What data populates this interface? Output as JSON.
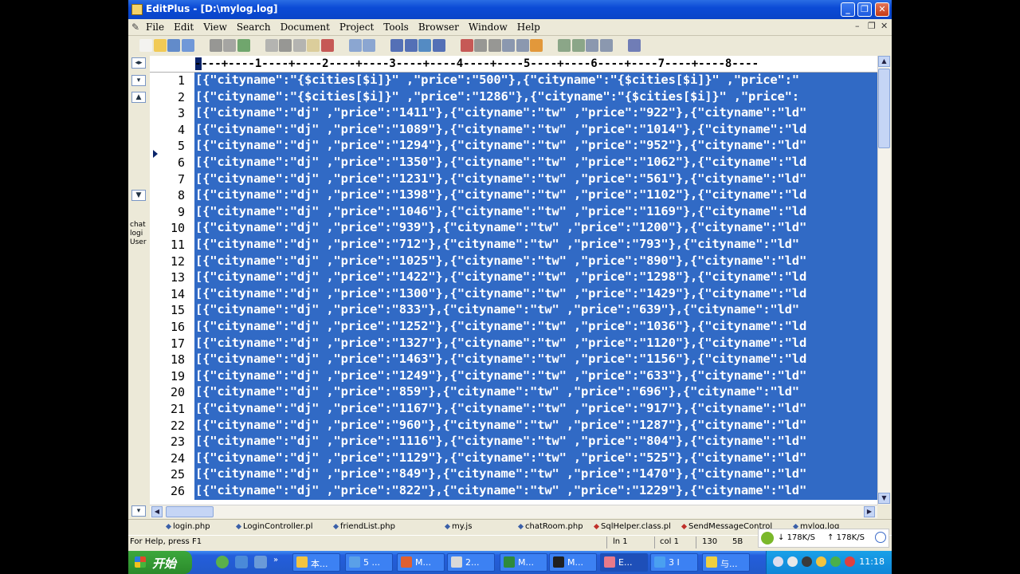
{
  "window": {
    "title": "EditPlus - [D:\\mylog.log]",
    "buttons": {
      "minimize": "_",
      "restore": "❐",
      "close": "✕"
    }
  },
  "menubar": {
    "items": [
      "File",
      "Edit",
      "View",
      "Search",
      "Document",
      "Project",
      "Tools",
      "Browser",
      "Window",
      "Help"
    ],
    "mdi_buttons": {
      "minimize": "–",
      "restore": "❐",
      "close": "✕"
    }
  },
  "toolbar": {
    "icons": [
      "new-file-icon",
      "open-folder-icon",
      "save-icon",
      "save-all-icon",
      "print-icon",
      "print-preview-icon",
      "spell-check-icon",
      "clipboard-icon",
      "cut-icon",
      "copy-icon",
      "paste-icon",
      "delete-icon",
      "undo-icon",
      "redo-icon",
      "find-icon",
      "replace-icon",
      "find-in-files-icon",
      "goto-icon",
      "font-icon",
      "hex-icon",
      "word-wrap-icon",
      "indent-icon",
      "ruler-icon",
      "check-icon",
      "browser-icon",
      "view-icon",
      "layout-icon",
      "fullscreen-icon",
      "help-icon"
    ]
  },
  "left_panel": {
    "lines": [
      "chat",
      "logi",
      "User"
    ]
  },
  "ruler": {
    "text": "----+----1----+----2----+----3----+----4----+----5----+----6----+----7----+----8----"
  },
  "editor": {
    "lines": [
      {
        "n": "1",
        "text": "[{\"cityname\":\"{$cities[$i]}\" ,\"price\":\"500\"},{\"cityname\":\"{$cities[$i]}\" ,\"price\":\""
      },
      {
        "n": "2",
        "text": "[{\"cityname\":\"{$cities[$i]}\" ,\"price\":\"1286\"},{\"cityname\":\"{$cities[$i]}\" ,\"price\":"
      },
      {
        "n": "3",
        "text": "[{\"cityname\":\"dj\" ,\"price\":\"1411\"},{\"cityname\":\"tw\" ,\"price\":\"922\"},{\"cityname\":\"ld\""
      },
      {
        "n": "4",
        "text": "[{\"cityname\":\"dj\" ,\"price\":\"1089\"},{\"cityname\":\"tw\" ,\"price\":\"1014\"},{\"cityname\":\"ld"
      },
      {
        "n": "5",
        "text": "[{\"cityname\":\"dj\" ,\"price\":\"1294\"},{\"cityname\":\"tw\" ,\"price\":\"952\"},{\"cityname\":\"ld\""
      },
      {
        "n": "6",
        "text": "[{\"cityname\":\"dj\" ,\"price\":\"1350\"},{\"cityname\":\"tw\" ,\"price\":\"1062\"},{\"cityname\":\"ld"
      },
      {
        "n": "7",
        "text": "[{\"cityname\":\"dj\" ,\"price\":\"1231\"},{\"cityname\":\"tw\" ,\"price\":\"561\"},{\"cityname\":\"ld\""
      },
      {
        "n": "8",
        "text": "[{\"cityname\":\"dj\" ,\"price\":\"1398\"},{\"cityname\":\"tw\" ,\"price\":\"1102\"},{\"cityname\":\"ld"
      },
      {
        "n": "9",
        "text": "[{\"cityname\":\"dj\" ,\"price\":\"1046\"},{\"cityname\":\"tw\" ,\"price\":\"1169\"},{\"cityname\":\"ld"
      },
      {
        "n": "10",
        "text": "[{\"cityname\":\"dj\" ,\"price\":\"939\"},{\"cityname\":\"tw\" ,\"price\":\"1200\"},{\"cityname\":\"ld\""
      },
      {
        "n": "11",
        "text": "[{\"cityname\":\"dj\" ,\"price\":\"712\"},{\"cityname\":\"tw\" ,\"price\":\"793\"},{\"cityname\":\"ld\" "
      },
      {
        "n": "12",
        "text": "[{\"cityname\":\"dj\" ,\"price\":\"1025\"},{\"cityname\":\"tw\" ,\"price\":\"890\"},{\"cityname\":\"ld\""
      },
      {
        "n": "13",
        "text": "[{\"cityname\":\"dj\" ,\"price\":\"1422\"},{\"cityname\":\"tw\" ,\"price\":\"1298\"},{\"cityname\":\"ld"
      },
      {
        "n": "14",
        "text": "[{\"cityname\":\"dj\" ,\"price\":\"1300\"},{\"cityname\":\"tw\" ,\"price\":\"1429\"},{\"cityname\":\"ld"
      },
      {
        "n": "15",
        "text": "[{\"cityname\":\"dj\" ,\"price\":\"833\"},{\"cityname\":\"tw\" ,\"price\":\"639\"},{\"cityname\":\"ld\" "
      },
      {
        "n": "16",
        "text": "[{\"cityname\":\"dj\" ,\"price\":\"1252\"},{\"cityname\":\"tw\" ,\"price\":\"1036\"},{\"cityname\":\"ld"
      },
      {
        "n": "17",
        "text": "[{\"cityname\":\"dj\" ,\"price\":\"1327\"},{\"cityname\":\"tw\" ,\"price\":\"1120\"},{\"cityname\":\"ld"
      },
      {
        "n": "18",
        "text": "[{\"cityname\":\"dj\" ,\"price\":\"1463\"},{\"cityname\":\"tw\" ,\"price\":\"1156\"},{\"cityname\":\"ld"
      },
      {
        "n": "19",
        "text": "[{\"cityname\":\"dj\" ,\"price\":\"1249\"},{\"cityname\":\"tw\" ,\"price\":\"633\"},{\"cityname\":\"ld\""
      },
      {
        "n": "20",
        "text": "[{\"cityname\":\"dj\" ,\"price\":\"859\"},{\"cityname\":\"tw\" ,\"price\":\"696\"},{\"cityname\":\"ld\" "
      },
      {
        "n": "21",
        "text": "[{\"cityname\":\"dj\" ,\"price\":\"1167\"},{\"cityname\":\"tw\" ,\"price\":\"917\"},{\"cityname\":\"ld\""
      },
      {
        "n": "22",
        "text": "[{\"cityname\":\"dj\" ,\"price\":\"960\"},{\"cityname\":\"tw\" ,\"price\":\"1287\"},{\"cityname\":\"ld\""
      },
      {
        "n": "23",
        "text": "[{\"cityname\":\"dj\" ,\"price\":\"1116\"},{\"cityname\":\"tw\" ,\"price\":\"804\"},{\"cityname\":\"ld\""
      },
      {
        "n": "24",
        "text": "[{\"cityname\":\"dj\" ,\"price\":\"1129\"},{\"cityname\":\"tw\" ,\"price\":\"525\"},{\"cityname\":\"ld\""
      },
      {
        "n": "25",
        "text": "[{\"cityname\":\"dj\" ,\"price\":\"849\"},{\"cityname\":\"tw\" ,\"price\":\"1470\"},{\"cityname\":\"ld\""
      },
      {
        "n": "26",
        "text": "[{\"cityname\":\"dj\" ,\"price\":\"822\"},{\"cityname\":\"tw\" ,\"price\":\"1229\"},{\"cityname\":\"ld\""
      }
    ]
  },
  "file_tabs": [
    {
      "label": "login.php",
      "modified": false
    },
    {
      "label": "LoginController.pl",
      "modified": false
    },
    {
      "label": "friendList.php",
      "modified": false
    },
    {
      "label": "my.js",
      "modified": false
    },
    {
      "label": "chatRoom.php",
      "modified": false
    },
    {
      "label": "SqlHelper.class.pl",
      "modified": true
    },
    {
      "label": "SendMessageControl",
      "modified": true
    },
    {
      "label": "mylog.log",
      "modified": false
    }
  ],
  "status_bar": {
    "help": "For Help, press F1",
    "line": "ln 1",
    "col": "col 1",
    "count": "130",
    "num": "5B"
  },
  "net_speed": {
    "download": "178K/S",
    "upload": "178K/S"
  },
  "taskbar": {
    "start_label": "开始",
    "tasks": [
      {
        "label": "本...",
        "icon": "folder-icon",
        "color": "#f2c440"
      },
      {
        "label": "5 ...",
        "icon": "messenger-icon",
        "color": "#5aa0e8"
      },
      {
        "label": "M...",
        "icon": "firefox-icon",
        "color": "#e06030"
      },
      {
        "label": "2...",
        "icon": "document-icon",
        "color": "#d8d8d8"
      },
      {
        "label": "M...",
        "icon": "excel-icon",
        "color": "#2e8a3c"
      },
      {
        "label": "M...",
        "icon": "cmd-icon",
        "color": "#202020"
      },
      {
        "label": "E...",
        "icon": "editplus-icon",
        "color": "#e87a8a"
      },
      {
        "label": "3 I",
        "icon": "ie-icon",
        "color": "#4aa0f0"
      },
      {
        "label": "与...",
        "icon": "chat-icon",
        "color": "#f0d040"
      }
    ],
    "clock": "11:18"
  }
}
